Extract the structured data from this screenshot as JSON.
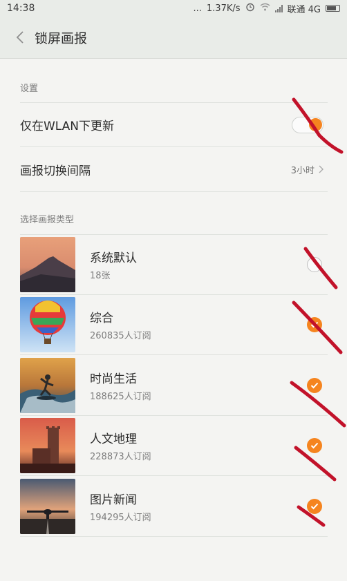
{
  "status_bar": {
    "time": "14:38",
    "dots": "...",
    "speed": "1.37K/s",
    "carrier": "联通 4G"
  },
  "header": {
    "back_icon": "chevron-left-icon",
    "title": "锁屏画报"
  },
  "settings": {
    "section_label": "设置",
    "wlan_only_label": "仅在WLAN下更新",
    "wlan_only_enabled": true,
    "interval_label": "画报切换间隔",
    "interval_value": "3小时"
  },
  "types": {
    "section_label": "选择画报类型",
    "items": [
      {
        "title": "系统默认",
        "subtitle": "18张",
        "selected": false,
        "image": "mountain-sunset"
      },
      {
        "title": "综合",
        "subtitle": "260835人订阅",
        "selected": true,
        "image": "hot-air-balloon"
      },
      {
        "title": "时尚生活",
        "subtitle": "188625人订阅",
        "selected": true,
        "image": "surfer"
      },
      {
        "title": "人文地理",
        "subtitle": "228873人订阅",
        "selected": true,
        "image": "castle-tower"
      },
      {
        "title": "图片新闻",
        "subtitle": "194295人订阅",
        "selected": true,
        "image": "airplane-runway"
      }
    ]
  },
  "colors": {
    "accent": "#f5841f",
    "background": "#f4f4f2",
    "header_bg": "#e9ece8",
    "annotation_red": "#c2122a"
  }
}
